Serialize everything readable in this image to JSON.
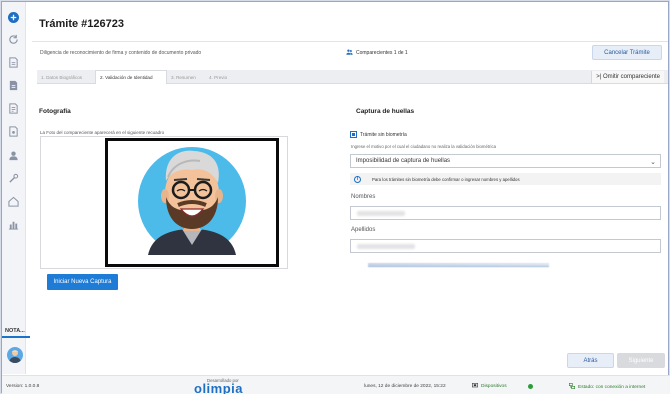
{
  "header": {
    "title": "Trámite #126723",
    "subtitle": "Diligencia de reconocimiento de firma y contenido de documento privado",
    "comparecientes": "Comparecientes 1 de 1",
    "cancel_label": "Cancelar Trámite"
  },
  "tabs": [
    {
      "label": "1. Datos Biográficos",
      "active": false
    },
    {
      "label": "2. Validación de Identidad",
      "active": true
    },
    {
      "label": "3. Resumen",
      "active": false
    },
    {
      "label": "4. Previo",
      "active": false
    }
  ],
  "omit_label": ">| Omitir compareciente",
  "photo": {
    "section_title": "Fotografía",
    "caption": "La Foto del compareciente aparecerá en el siguiente recuadro",
    "capture_button": "Iniciar Nueva Captura"
  },
  "fingerprint": {
    "section_title": "Captura de huellas",
    "checkbox_label": "Trámite sin biometría",
    "checkbox_checked": true,
    "motive_label": "Ingrese el motivo por el cual el ciudadano no realiza la validación biométrica",
    "select_value": "Imposibilidad de captura de huellas",
    "info_text": "Para los trámites sin biometría debe confirmar o ingresar nombres y apellidos",
    "names_label": "Nombres",
    "surnames_label": "Apellidos"
  },
  "nav": {
    "back_label": "Atrás",
    "next_label": "Siguiente"
  },
  "sidebar": {
    "nota_label": "NOTA...",
    "icons": [
      "plus-circle-icon",
      "refresh-icon",
      "document-icon",
      "document-icon",
      "document-icon",
      "document-icon",
      "user-icon",
      "tools-icon",
      "home-icon",
      "chart-icon"
    ]
  },
  "footer": {
    "version": "Version: 1.0.0.8",
    "developed_by": "Desarrollado por",
    "brand": "olimpia",
    "datetime": "lunes, 12 de diciembre de 2022, 15:22",
    "devices_label": "Dispositivos",
    "status_label": "Estado: con conexión a internet"
  },
  "colors": {
    "accent": "#1e7bd6",
    "ok": "#2a9d3a"
  }
}
